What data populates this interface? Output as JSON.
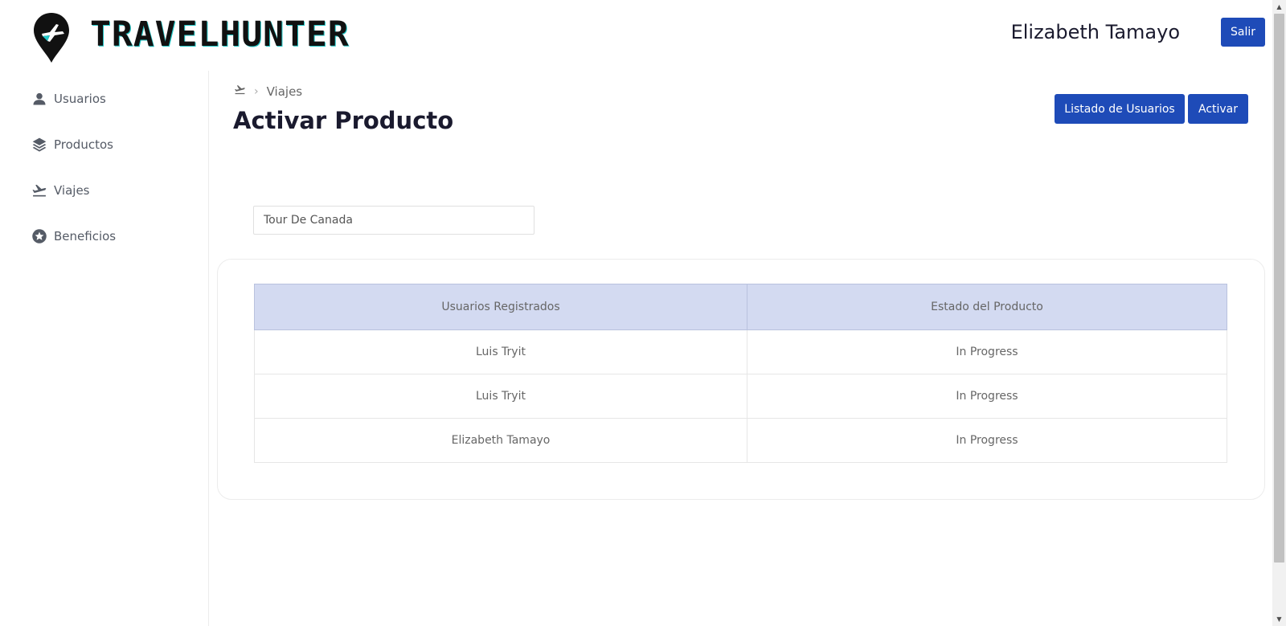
{
  "header": {
    "brand": "TRAVELHUNTER",
    "user_name": "Elizabeth Tamayo",
    "logout_label": "Salir",
    "accent_color": "#1e4bb8"
  },
  "sidebar": {
    "items": [
      {
        "label": "Usuarios",
        "icon": "user-icon"
      },
      {
        "label": "Productos",
        "icon": "layers-icon"
      },
      {
        "label": "Viajes",
        "icon": "flight-takeoff-icon"
      },
      {
        "label": "Beneficios",
        "icon": "star-badge-icon"
      }
    ]
  },
  "main": {
    "breadcrumb": {
      "icon": "flight-takeoff-icon",
      "current": "Viajes"
    },
    "title": "Activar Producto",
    "actions": {
      "list_users": "Listado de Usuarios",
      "activate": "Activar"
    },
    "product_input_value": "Tour De Canada",
    "table": {
      "headers": [
        "Usuarios Registrados",
        "Estado del Producto"
      ],
      "rows": [
        {
          "user": "Luis Tryit",
          "status": "In Progress"
        },
        {
          "user": "Luis Tryit",
          "status": "In Progress"
        },
        {
          "user": "Elizabeth Tamayo",
          "status": "In Progress"
        }
      ],
      "header_color": "#d3daf1"
    }
  }
}
